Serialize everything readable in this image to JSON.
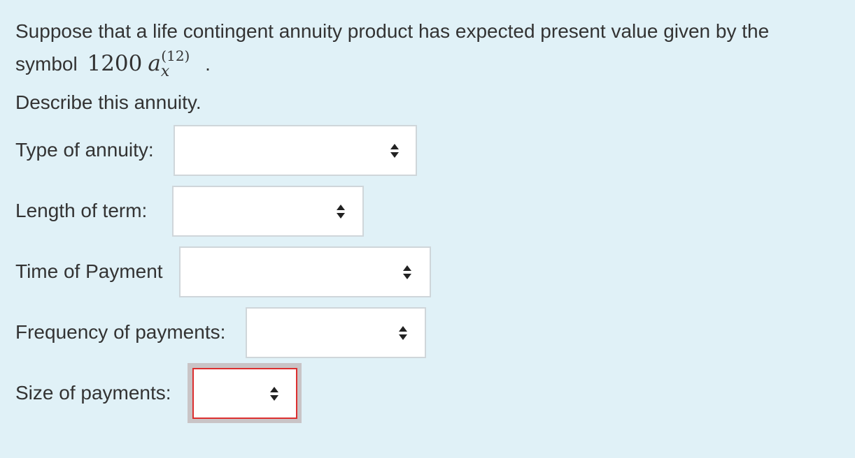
{
  "question": {
    "line1": "Suppose that a life contingent annuity product has expected present value given by the",
    "line2_prefix": "symbol",
    "math": {
      "coefficient": "1200",
      "symbol": "a",
      "subscript": "x",
      "superscript": "(12)"
    },
    "line2_suffix": "."
  },
  "prompt": "Describe this annuity.",
  "fields": [
    {
      "label": "Type of annuity:",
      "value": "",
      "state": "normal"
    },
    {
      "label": "Length of term:",
      "value": "",
      "state": "normal"
    },
    {
      "label": "Time of Payment",
      "value": "",
      "state": "normal"
    },
    {
      "label": "Frequency of payments:",
      "value": "",
      "state": "normal"
    },
    {
      "label": "Size of payments:",
      "value": "",
      "state": "error"
    }
  ],
  "colors": {
    "background": "#e0f1f7",
    "error_border": "#dc2f2f",
    "focus_frame": "#c9c4c6"
  },
  "icons": {
    "select_arrows": "up-down-caret-icon"
  }
}
